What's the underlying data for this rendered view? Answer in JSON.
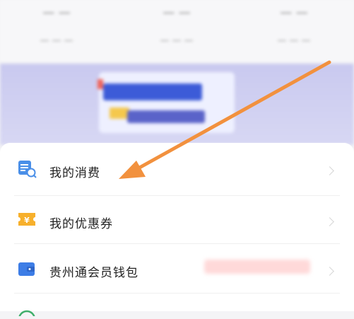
{
  "menu": {
    "items": [
      {
        "label": "我的消费",
        "icon": "consumption-icon"
      },
      {
        "label": "我的优惠券",
        "icon": "coupon-icon"
      },
      {
        "label": "贵州通会员钱包",
        "icon": "wallet-icon"
      }
    ]
  },
  "colors": {
    "arrow": "#f2913e",
    "consumption_icon": "#4a8fe8",
    "coupon_icon": "#f7b02c",
    "wallet_icon": "#3d7de6"
  }
}
